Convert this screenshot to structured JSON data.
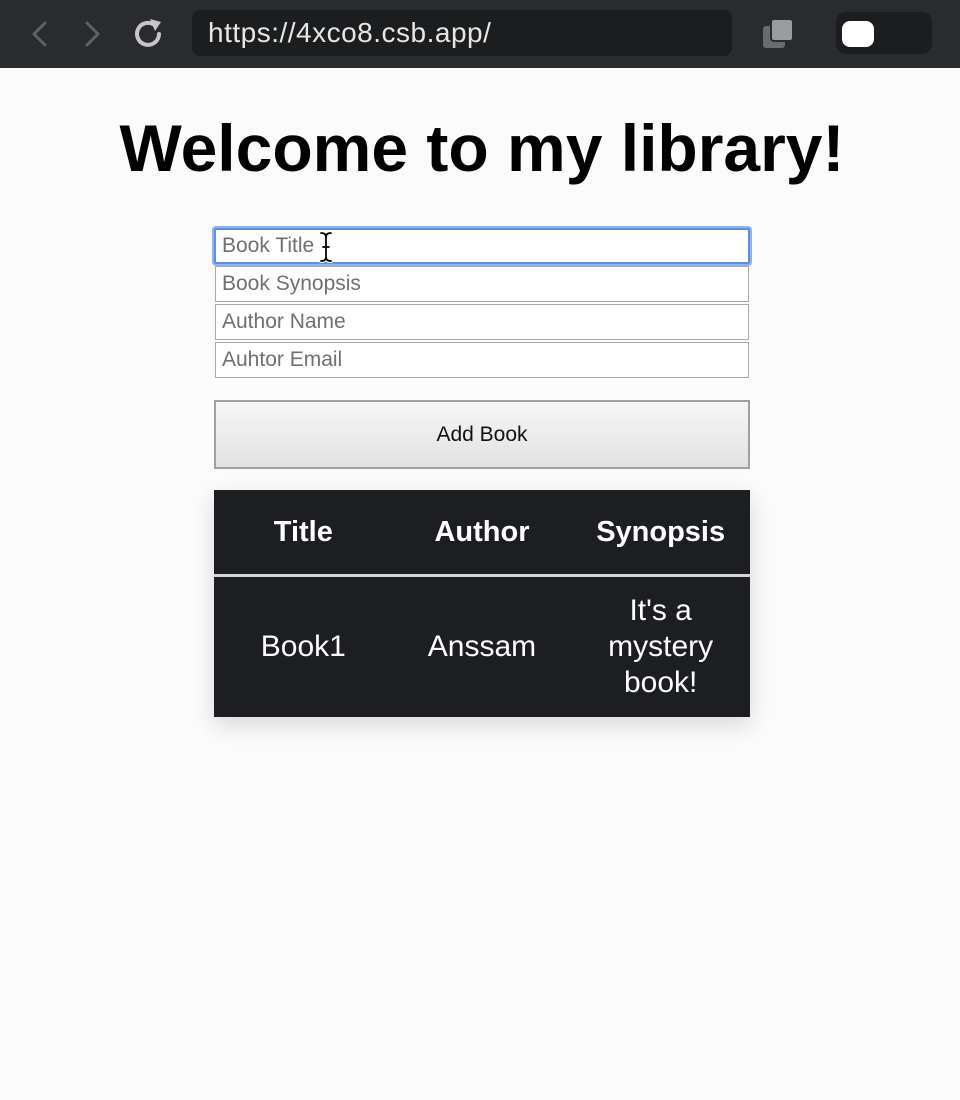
{
  "browser": {
    "url": "https://4xco8.csb.app/",
    "icons": {
      "back": "chevron-left-icon",
      "forward": "chevron-right-icon",
      "reload": "reload-icon",
      "copy": "copy-icon",
      "toggle": "toggle-switch"
    }
  },
  "page": {
    "title": "Welcome to my library!"
  },
  "form": {
    "title_placeholder": "Book Title",
    "synopsis_placeholder": "Book Synopsis",
    "author_name_placeholder": "Author Name",
    "author_email_placeholder": "Auhtor Email",
    "submit_label": "Add Book",
    "focused_field": "title"
  },
  "table": {
    "headers": [
      "Title",
      "Author",
      "Synopsis"
    ],
    "rows": [
      [
        "Book1",
        "Anssam",
        "It's a mystery book!"
      ]
    ]
  },
  "colors": {
    "chrome_bg": "#2a2b2e",
    "address_bg": "#1c1d1f",
    "page_bg": "#fbfbfb",
    "table_bg": "#1d1e21",
    "focus_ring": "#5b8fe8"
  }
}
